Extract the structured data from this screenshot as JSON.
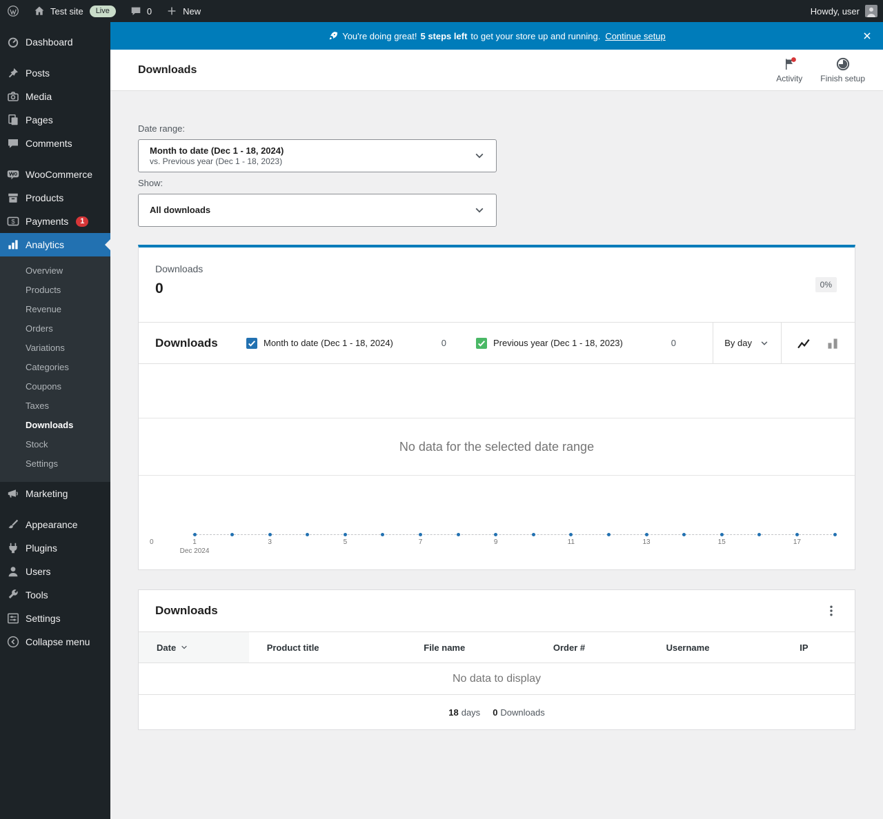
{
  "admin_bar": {
    "site_name": "Test site",
    "live_badge": "Live",
    "comments_count": "0",
    "new_label": "New",
    "howdy": "Howdy, user"
  },
  "sidebar": {
    "items": [
      {
        "label": "Dashboard",
        "icon": "dashboard-icon"
      },
      {
        "label": "Posts",
        "icon": "posts-icon",
        "separator_before": true
      },
      {
        "label": "Media",
        "icon": "media-icon"
      },
      {
        "label": "Pages",
        "icon": "pages-icon"
      },
      {
        "label": "Comments",
        "icon": "comments-icon"
      },
      {
        "label": "WooCommerce",
        "icon": "woocommerce-icon",
        "separator_before": true
      },
      {
        "label": "Products",
        "icon": "products-icon"
      },
      {
        "label": "Payments",
        "icon": "payments-icon",
        "badge": "1"
      },
      {
        "label": "Analytics",
        "icon": "analytics-icon",
        "active": true,
        "submenu": [
          {
            "label": "Overview"
          },
          {
            "label": "Products"
          },
          {
            "label": "Revenue"
          },
          {
            "label": "Orders"
          },
          {
            "label": "Variations"
          },
          {
            "label": "Categories"
          },
          {
            "label": "Coupons"
          },
          {
            "label": "Taxes"
          },
          {
            "label": "Downloads",
            "active": true
          },
          {
            "label": "Stock"
          },
          {
            "label": "Settings"
          }
        ]
      },
      {
        "label": "Marketing",
        "icon": "marketing-icon"
      },
      {
        "label": "Appearance",
        "icon": "appearance-icon",
        "separator_before": true
      },
      {
        "label": "Plugins",
        "icon": "plugins-icon"
      },
      {
        "label": "Users",
        "icon": "users-icon"
      },
      {
        "label": "Tools",
        "icon": "tools-icon"
      },
      {
        "label": "Settings",
        "icon": "settings-icon"
      },
      {
        "label": "Collapse menu",
        "icon": "collapse-icon"
      }
    ]
  },
  "banner": {
    "icon": "rocket-icon",
    "message_prefix": "You're doing great!",
    "steps_left": "5 steps left",
    "message_suffix": "to get your store up and running.",
    "cta": "Continue setup"
  },
  "header": {
    "title": "Downloads",
    "activity_label": "Activity",
    "finish_setup_label": "Finish setup"
  },
  "filters": {
    "date_range_label": "Date range:",
    "date_range_value": "Month to date (Dec 1 - 18, 2024)",
    "date_range_compare": "vs. Previous year (Dec 1 - 18, 2023)",
    "show_label": "Show:",
    "show_value": "All downloads"
  },
  "summary": {
    "label": "Downloads",
    "value": "0",
    "delta": "0%"
  },
  "chart": {
    "title": "Downloads",
    "interval": "By day",
    "empty_message": "No data for the selected date range",
    "series": [
      {
        "label": "Month to date (Dec 1 - 18, 2024)",
        "value": "0",
        "color": "#2271b1"
      },
      {
        "label": "Previous year (Dec 1 - 18, 2023)",
        "value": "0",
        "color": "#4ab866"
      }
    ],
    "x_axis": {
      "points": 18,
      "tick_labels": [
        "1",
        "3",
        "5",
        "7",
        "9",
        "11",
        "13",
        "15",
        "17"
      ],
      "month_label": "Dec 2024",
      "y_zero_label": "0"
    }
  },
  "chart_data": {
    "type": "line",
    "title": "Downloads",
    "x_ticks": [
      "1",
      "3",
      "5",
      "7",
      "9",
      "11",
      "13",
      "15",
      "17"
    ],
    "x_axis_note": "Days 1-18 of Dec 2024",
    "series": [
      {
        "name": "Month to date (Dec 1 - 18, 2024)",
        "values": []
      },
      {
        "name": "Previous year (Dec 1 - 18, 2023)",
        "values": []
      }
    ],
    "ylim": [
      0,
      0
    ],
    "empty_message": "No data for the selected date range",
    "legend_position": "top"
  },
  "table": {
    "title": "Downloads",
    "columns": [
      {
        "label": "Date",
        "sorted": true
      },
      {
        "label": "Product title"
      },
      {
        "label": "File name"
      },
      {
        "label": "Order #"
      },
      {
        "label": "Username"
      },
      {
        "label": "IP"
      }
    ],
    "empty_message": "No data to display",
    "footer": {
      "days_value": "18",
      "days_label": "days",
      "downloads_value": "0",
      "downloads_label": "Downloads"
    }
  }
}
